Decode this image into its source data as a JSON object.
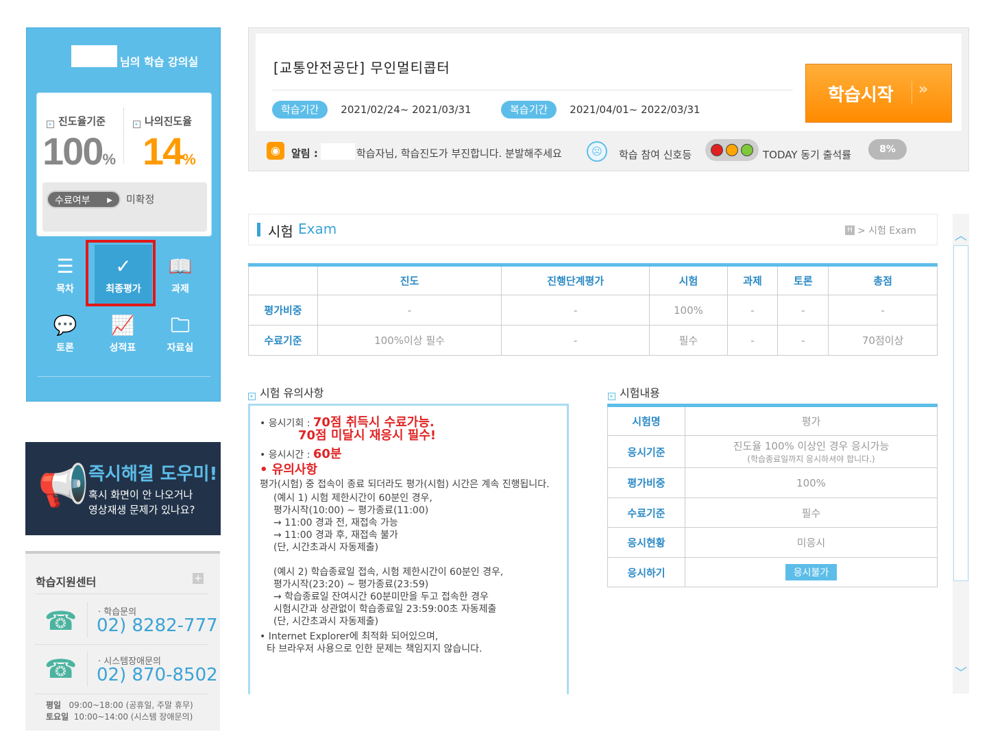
{
  "sidebar": {
    "classroom_title": "님의 학습 강의실",
    "progress_basis_label": "진도율기준",
    "progress_basis_value": "100",
    "my_progress_label": "나의진도율",
    "my_progress_value": "14",
    "percent_unit": "%",
    "completion_label": "수료여부",
    "completion_value": "미확정",
    "menu": [
      {
        "label": "목차",
        "icon": "list-icon"
      },
      {
        "label": "최종평가",
        "icon": "check-icon"
      },
      {
        "label": "과제",
        "icon": "book-icon"
      },
      {
        "label": "토론",
        "icon": "chat-icon"
      },
      {
        "label": "성적표",
        "icon": "chart-icon"
      },
      {
        "label": "자료실",
        "icon": "folder-icon"
      }
    ]
  },
  "banner": {
    "title": "즉시해결 도우미!",
    "line1": "혹시 화면이 안 나오거나",
    "line2": "영상재생 문제가 있나요?"
  },
  "support": {
    "title": "학습지원센터",
    "study_label": "학습문의",
    "study_phone": "02) 8282-777",
    "system_label": "시스템장애문의",
    "system_phone": "02) 870-8502",
    "weekday_label": "평일",
    "weekday_hours": "09:00~18:00 (공휴일, 주말 휴무)",
    "saturday_label": "토요일",
    "saturday_hours": "10:00~14:00 (시스템 장애문의)"
  },
  "course": {
    "title": "[교통안전공단] 무인멀티콥터",
    "study_period_label": "학습기간",
    "study_period": "2021/02/24~ 2021/03/31",
    "review_period_label": "복습기간",
    "review_period": "2021/04/01~ 2022/03/31",
    "start_button": "학습시작",
    "notice_label": "알림 :",
    "notice_text": "학습자님, 학습진도가 부진합니다. 분발해주세요",
    "signal_label": "학습 참여 신호등",
    "today_label": "TODAY 동기 출석률",
    "today_value": "8%"
  },
  "exam_header": {
    "title": "시험",
    "title_en": "Exam",
    "breadcrumb": "> 시험 Exam"
  },
  "score_table": {
    "headers": [
      "진도",
      "진행단계평가",
      "시험",
      "과제",
      "토론",
      "총점"
    ],
    "rows": [
      {
        "label": "평가비중",
        "cells": [
          "-",
          "-",
          "100%",
          "-",
          "-",
          "-"
        ]
      },
      {
        "label": "수료기준",
        "cells": [
          "100%이상 필수",
          "-",
          "필수",
          "-",
          "-",
          "70점이상"
        ]
      }
    ]
  },
  "notice_section": {
    "title": "시험 유의사항",
    "chance_label": "응시기회 :",
    "chance_text1": "70점 취득시 수료가능.",
    "chance_text2": "70점 미달시 재응시 필수!",
    "time_label": "응시시간 :",
    "time_value": "60분",
    "caution_title": "유의사항",
    "p1": "평가(시험) 중 접속이 종료 되더라도 평가(시험) 시간은 계속 진행됩니다.",
    "ex1": [
      "(예시 1) 시험 제한시간이 60분인 경우,",
      "평가시작(10:00) ~ 평가종료(11:00)",
      "→ 11:00 경과 전, 재접속 가능",
      "→ 11:00 경과 후, 재접속 불가",
      "(단, 시간초과시 자동제출)"
    ],
    "ex2": [
      "(예시 2) 학습종료일 접속, 시험 제한시간이 60분인 경우,",
      "평가시작(23:20) ~ 평가종료(23:59)",
      "→ 학습종료일 잔여시간 60분미만을 두고 접속한 경우",
      "시험시간과 상관없이 학습종료일 23:59:00초 자동제출",
      "(단, 시간초과시 자동제출)"
    ],
    "ie1": "Internet Explorer에 최적화 되어있으며,",
    "ie2": "타 브라우저 사용으로 인한 문제는 책임지지 않습니다."
  },
  "exam_info": {
    "title": "시험내용",
    "rows": [
      {
        "label": "시험명",
        "value": "평가"
      },
      {
        "label": "응시기준",
        "value": "진도율 100% 이상인 경우 응시가능",
        "sub": "(학습종료일까지 응시하셔야 합니다.)"
      },
      {
        "label": "평가비중",
        "value": "100%"
      },
      {
        "label": "수료기준",
        "value": "필수"
      },
      {
        "label": "응시현황",
        "value": "미응시"
      },
      {
        "label": "응시하기",
        "button": "응시불가"
      }
    ]
  }
}
